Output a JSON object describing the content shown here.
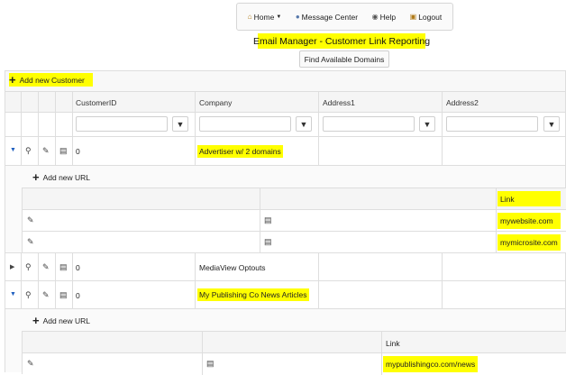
{
  "nav": {
    "home": "Home",
    "message_center": "Message Center",
    "help": "Help",
    "logout": "Logout"
  },
  "title": "Email Manager - Customer Link Reporting",
  "find_domains": "Find Available Domains",
  "grid": {
    "add_customer": "Add new Customer",
    "columns": [
      "CustomerID",
      "Company",
      "Address1",
      "Address2"
    ],
    "rows": [
      {
        "id": "0",
        "company": "Advertiser w/ 2 domains"
      },
      {
        "id": "0",
        "company": "MediaView Optouts"
      },
      {
        "id": "0",
        "company": "My Publishing Co News Articles"
      }
    ]
  },
  "sub1": {
    "add_url": "Add new URL",
    "link_header": "Link",
    "links": [
      "mywebsite.com",
      "mymicrosite.com"
    ]
  },
  "sub2": {
    "add_url": "Add new URL",
    "link_header": "Link",
    "links": [
      "mypublishingco.com/news"
    ]
  },
  "colors": {
    "highlight": "#ffff00",
    "border": "#dedede",
    "expander": "#1f5fbf"
  }
}
